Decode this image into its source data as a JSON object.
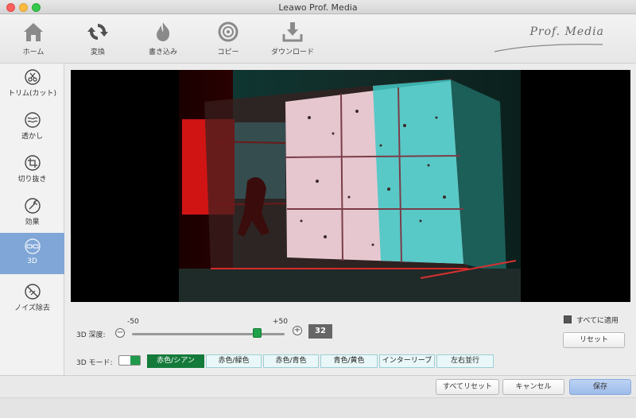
{
  "window": {
    "title": "Leawo Prof. Media"
  },
  "toolbar": {
    "items": [
      {
        "label": "ホーム",
        "icon": "home-icon"
      },
      {
        "label": "変換",
        "icon": "convert-icon"
      },
      {
        "label": "書き込み",
        "icon": "burn-icon"
      },
      {
        "label": "コピー",
        "icon": "copy-disc-icon"
      },
      {
        "label": "ダウンロード",
        "icon": "download-icon"
      }
    ],
    "brand": "Prof. Media"
  },
  "sidebar": {
    "items": [
      {
        "label": "トリム(カット)",
        "icon": "trim-icon"
      },
      {
        "label": "透かし",
        "icon": "watermark-icon"
      },
      {
        "label": "切り抜き",
        "icon": "crop-icon"
      },
      {
        "label": "効果",
        "icon": "effect-icon"
      },
      {
        "label": "3D",
        "icon": "3d-glasses-icon",
        "active": true
      },
      {
        "label": "ノイズ除去",
        "icon": "denoise-icon"
      }
    ],
    "active_color": "#7fa6d6"
  },
  "depth": {
    "label": "3D 深度:",
    "min_label": "-50",
    "max_label": "+50",
    "min": -50,
    "max": 50,
    "value": "32"
  },
  "apply_all": {
    "label": "すべてに適用",
    "checked": true
  },
  "reset_label": "リセット",
  "mode": {
    "label": "3D モード:",
    "options": [
      "赤色/シアン",
      "赤色/緑色",
      "赤色/青色",
      "青色/黄色",
      "インターリーブ",
      "左右並行"
    ],
    "selected": "赤色/シアン",
    "accent": "#147a3a"
  },
  "footer": {
    "reset_all_label": "すべてリセット",
    "cancel_label": "キャンセル",
    "save_label": "保存"
  }
}
